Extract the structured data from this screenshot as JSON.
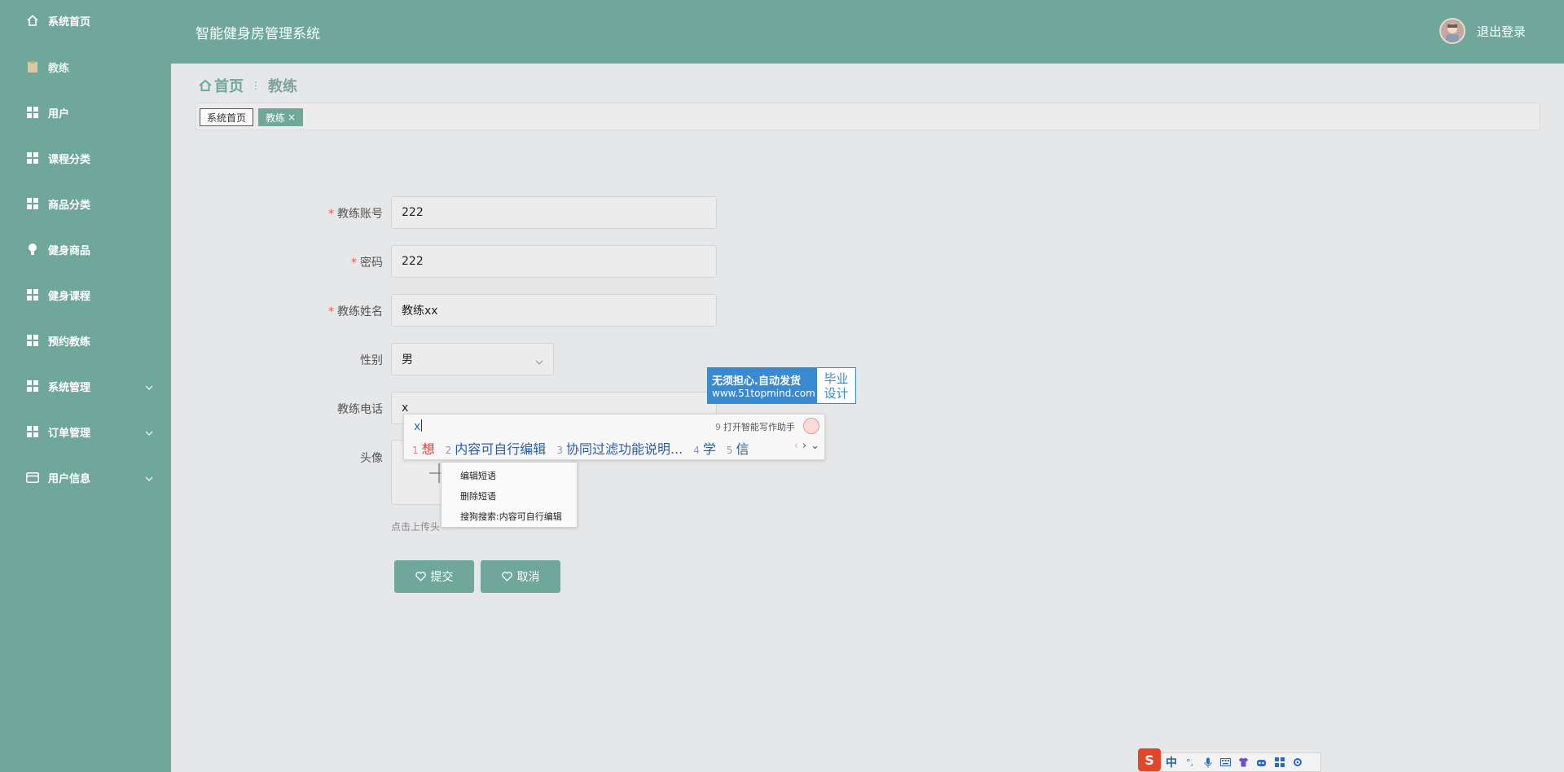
{
  "sidebar": {
    "items": [
      {
        "label": "系统首页",
        "icon": "home-icon"
      },
      {
        "label": "教练",
        "icon": "clipboard-icon"
      },
      {
        "label": "用户",
        "icon": "grid-icon"
      },
      {
        "label": "课程分类",
        "icon": "grid-icon"
      },
      {
        "label": "商品分类",
        "icon": "grid-icon"
      },
      {
        "label": "健身商品",
        "icon": "bulb-icon"
      },
      {
        "label": "健身课程",
        "icon": "grid-icon"
      },
      {
        "label": "预约教练",
        "icon": "grid-icon"
      },
      {
        "label": "系统管理",
        "icon": "grid-icon"
      },
      {
        "label": "订单管理",
        "icon": "grid-icon"
      },
      {
        "label": "用户信息",
        "icon": "card-icon"
      }
    ]
  },
  "header": {
    "title": "智能健身房管理系统",
    "logout": "退出登录"
  },
  "breadcrumb": {
    "home": "首页",
    "current": "教练"
  },
  "tags": [
    {
      "label": "系统首页"
    },
    {
      "label": "教练"
    }
  ],
  "form": {
    "account_label": "教练账号",
    "account_value": "222",
    "password_label": "密码",
    "password_value": "222",
    "name_label": "教练姓名",
    "name_value": "教练xx",
    "gender_label": "性别",
    "gender_value": "男",
    "phone_label": "教练电话",
    "phone_value": "x",
    "avatar_label": "头像",
    "avatar_hint": "点击上传头",
    "submit": "提交",
    "cancel": "取消"
  },
  "ime": {
    "typed": "x",
    "assist_num": "9",
    "assist": "打开智能写作助手",
    "candidates": [
      {
        "n": "1",
        "text": "想"
      },
      {
        "n": "2",
        "text": "内容可自行编辑"
      },
      {
        "n": "3",
        "text": "协同过滤功能说明..."
      },
      {
        "n": "4",
        "text": "学"
      },
      {
        "n": "5",
        "text": "信"
      }
    ],
    "menu": [
      "编辑短语",
      "删除短语",
      "搜狗搜索:内容可自行编辑"
    ],
    "toolbar_logo": "S",
    "toolbar_lang": "中",
    "toolbar_punct": "°,"
  },
  "ad": {
    "line1": "无须担心.自动发货",
    "line2": "www.51topmind.com",
    "right1": "毕业",
    "right2": "设计"
  },
  "colors": {
    "theme": "#6fa89a",
    "required": "#e25c5c",
    "ad": "#3a8ad1"
  }
}
